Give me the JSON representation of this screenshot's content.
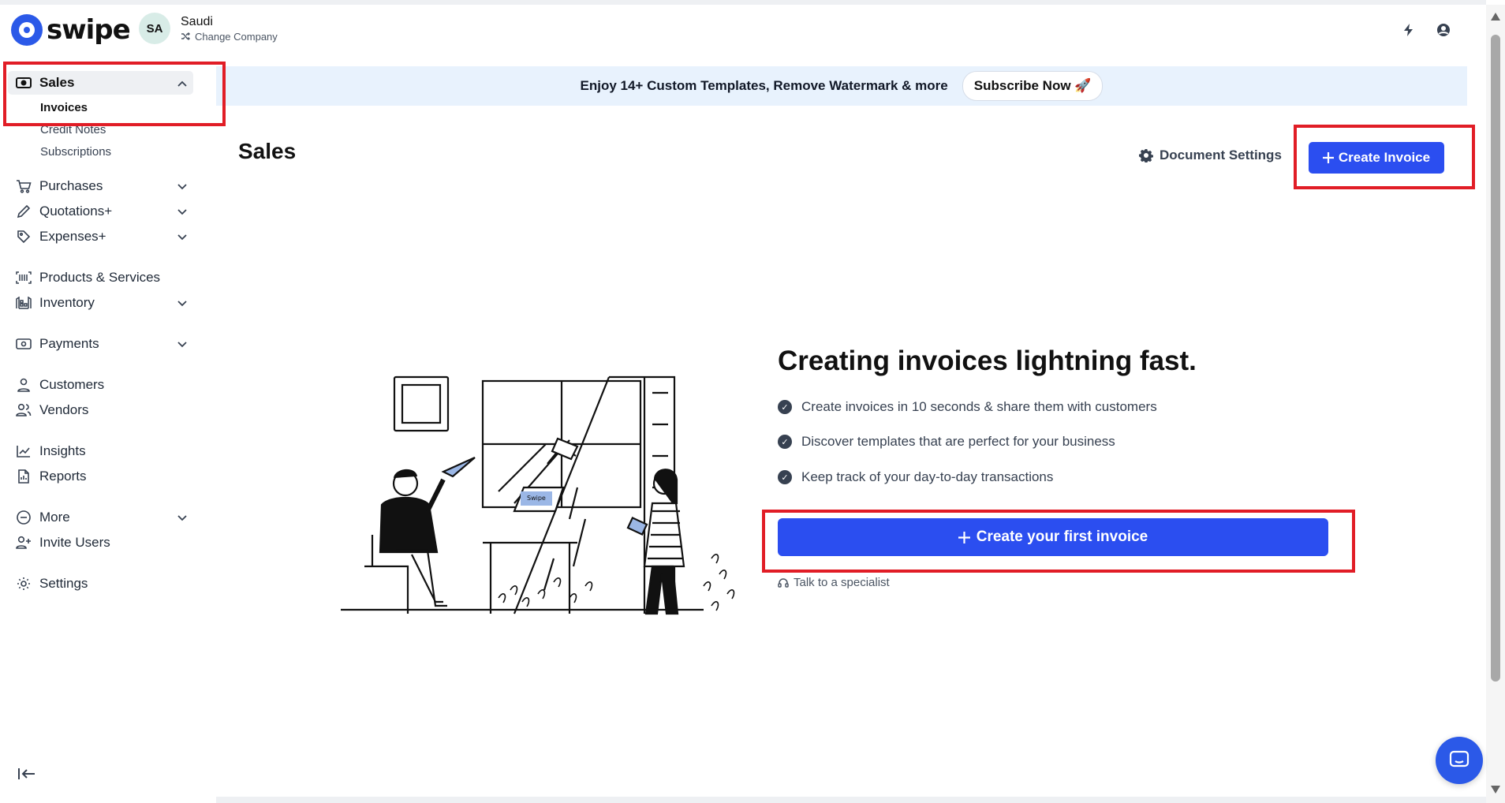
{
  "brand": {
    "name": "swipe",
    "accent": "#2b4ef0"
  },
  "company": {
    "initials": "SA",
    "name": "Saudi",
    "change_label": "Change Company"
  },
  "sidebar": {
    "sales": {
      "label": "Sales",
      "sub": [
        "Invoices",
        "Credit Notes",
        "Subscriptions"
      ]
    },
    "items": [
      {
        "label": "Purchases"
      },
      {
        "label": "Quotations+"
      },
      {
        "label": "Expenses+"
      },
      {
        "label": "Products & Services"
      },
      {
        "label": "Inventory"
      },
      {
        "label": "Payments"
      },
      {
        "label": "Customers"
      },
      {
        "label": "Vendors"
      },
      {
        "label": "Insights"
      },
      {
        "label": "Reports"
      },
      {
        "label": "More"
      },
      {
        "label": "Invite Users"
      },
      {
        "label": "Settings"
      }
    ]
  },
  "promo": {
    "text": "Enjoy 14+ Custom Templates, Remove Watermark & more",
    "button": "Subscribe Now 🚀"
  },
  "main": {
    "title": "Sales",
    "doc_settings": "Document Settings",
    "create_invoice": "Create Invoice",
    "hero_title": "Creating invoices lightning fast.",
    "features": [
      "Create invoices in 10 seconds & share them with customers",
      "Discover templates that are perfect for your business",
      "Keep track of your day-to-day transactions"
    ],
    "first_invoice": "Create your first invoice",
    "specialist": "Talk to a specialist"
  },
  "illustration": {
    "laptop_label": "Swipe"
  }
}
